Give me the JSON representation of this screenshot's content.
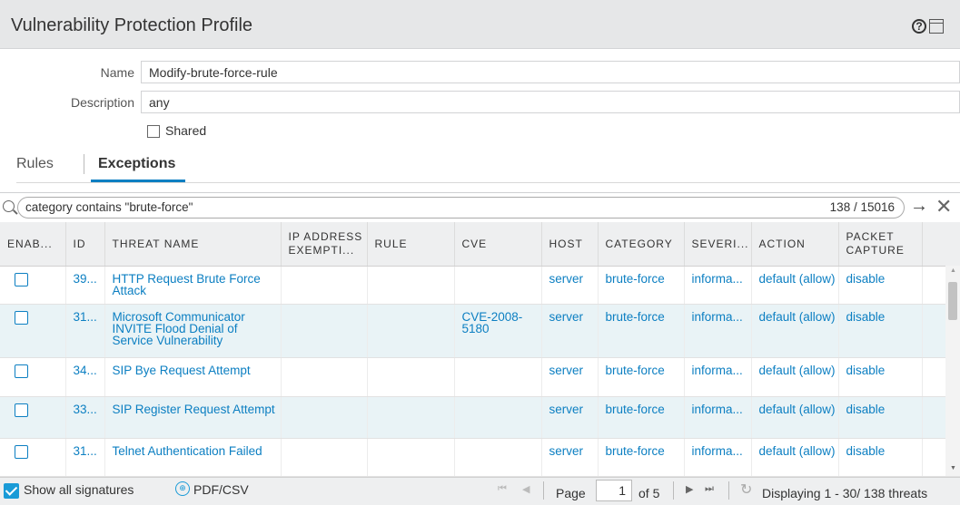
{
  "window": {
    "title": "Vulnerability Protection Profile",
    "help_glyph": "?"
  },
  "form": {
    "name_label": "Name",
    "name_value": "Modify-brute-force-rule",
    "description_label": "Description",
    "description_value": "any",
    "shared_label": "Shared"
  },
  "tabs": [
    {
      "label": "Rules",
      "active": false
    },
    {
      "label": "Exceptions",
      "active": true
    }
  ],
  "search": {
    "query": "category contains \"brute-force\"",
    "count": "138 / 15016",
    "go_glyph": "→",
    "clear_glyph": "✕"
  },
  "table": {
    "columns": [
      "ENAB...",
      "ID",
      "THREAT NAME",
      "IP ADDRESS EXEMPTI...",
      "RULE",
      "CVE",
      "HOST",
      "CATEGORY",
      "SEVERI...",
      "ACTION",
      "PACKET CAPTURE"
    ],
    "rows": [
      {
        "id": "39...",
        "threat": "HTTP Request Brute Force Attack",
        "ip": "",
        "rule": "",
        "cve": "",
        "host": "server",
        "category": "brute-force",
        "severity": "informa...",
        "action": "default (allow)",
        "capture": "disable"
      },
      {
        "id": "31...",
        "threat": "Microsoft Communicator INVITE Flood Denial of Service Vulnerability",
        "ip": "",
        "rule": "",
        "cve": "CVE-2008-5180",
        "host": "server",
        "category": "brute-force",
        "severity": "informa...",
        "action": "default (allow)",
        "capture": "disable"
      },
      {
        "id": "34...",
        "threat": "SIP Bye Request Attempt",
        "ip": "",
        "rule": "",
        "cve": "",
        "host": "server",
        "category": "brute-force",
        "severity": "informa...",
        "action": "default (allow)",
        "capture": "disable"
      },
      {
        "id": "33...",
        "threat": "SIP Register Request Attempt",
        "ip": "",
        "rule": "",
        "cve": "",
        "host": "server",
        "category": "brute-force",
        "severity": "informa...",
        "action": "default (allow)",
        "capture": "disable"
      },
      {
        "id": "31...",
        "threat": "Telnet Authentication Failed",
        "ip": "",
        "rule": "",
        "cve": "",
        "host": "server",
        "category": "brute-force",
        "severity": "informa...",
        "action": "default (allow)",
        "capture": "disable"
      }
    ]
  },
  "footer": {
    "show_all_label": "Show all signatures",
    "pdf_label": "PDF/CSV",
    "page_label": "Page",
    "page_value": "1",
    "of_label": "of 5",
    "display_label": "Displaying 1 - 30/ 138 threats"
  },
  "colors": {
    "accent": "#0c7fc2",
    "alt_row": "#e9f3f6",
    "header_bg": "#eeeff0"
  }
}
